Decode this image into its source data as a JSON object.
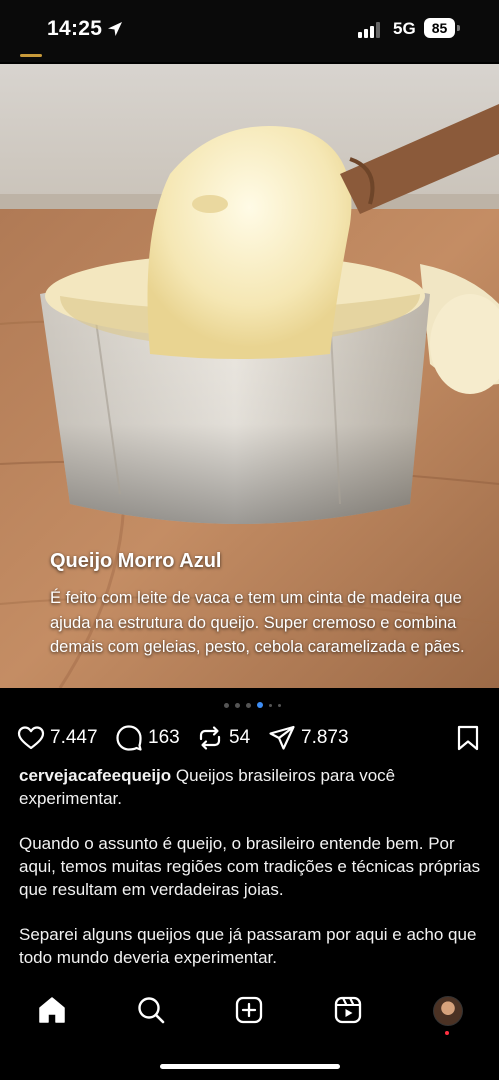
{
  "status_bar": {
    "time": "14:25",
    "network": "5G",
    "battery": "85",
    "location_icon": "location-arrow-icon",
    "signal_icon": "cellular-signal-icon"
  },
  "post": {
    "image_overlay": {
      "title": "Queijo Morro Azul",
      "description": "É feito com leite de vaca e tem um cinta de madeira que ajuda na estrutura do queijo. Super cremoso e combina demais com geleias, pesto, cebola caramelizada e pães."
    },
    "carousel": {
      "total_dots": 6,
      "active_index": 3
    },
    "actions": {
      "likes": "7.447",
      "comments": "163",
      "reposts": "54",
      "shares": "7.873"
    },
    "caption": {
      "username": "cervejacafeequeijo",
      "text": "Queijos brasileiros para você experimentar.",
      "paragraph_2": "Quando o assunto é queijo, o brasileiro entende bem. Por aqui, temos muitas regiões com tradições e técnicas próprias que resultam em verdadeiras joias.",
      "paragraph_3": "Separei alguns queijos que já passaram por aqui e acho que todo mundo deveria experimentar."
    }
  },
  "bottom_nav": {
    "items": [
      "home-icon",
      "search-icon",
      "create-post-icon",
      "reels-icon",
      "profile-avatar"
    ]
  },
  "colors": {
    "background": "#000000",
    "carousel_active": "#3d8df5",
    "notification_dot": "#ff3040"
  }
}
